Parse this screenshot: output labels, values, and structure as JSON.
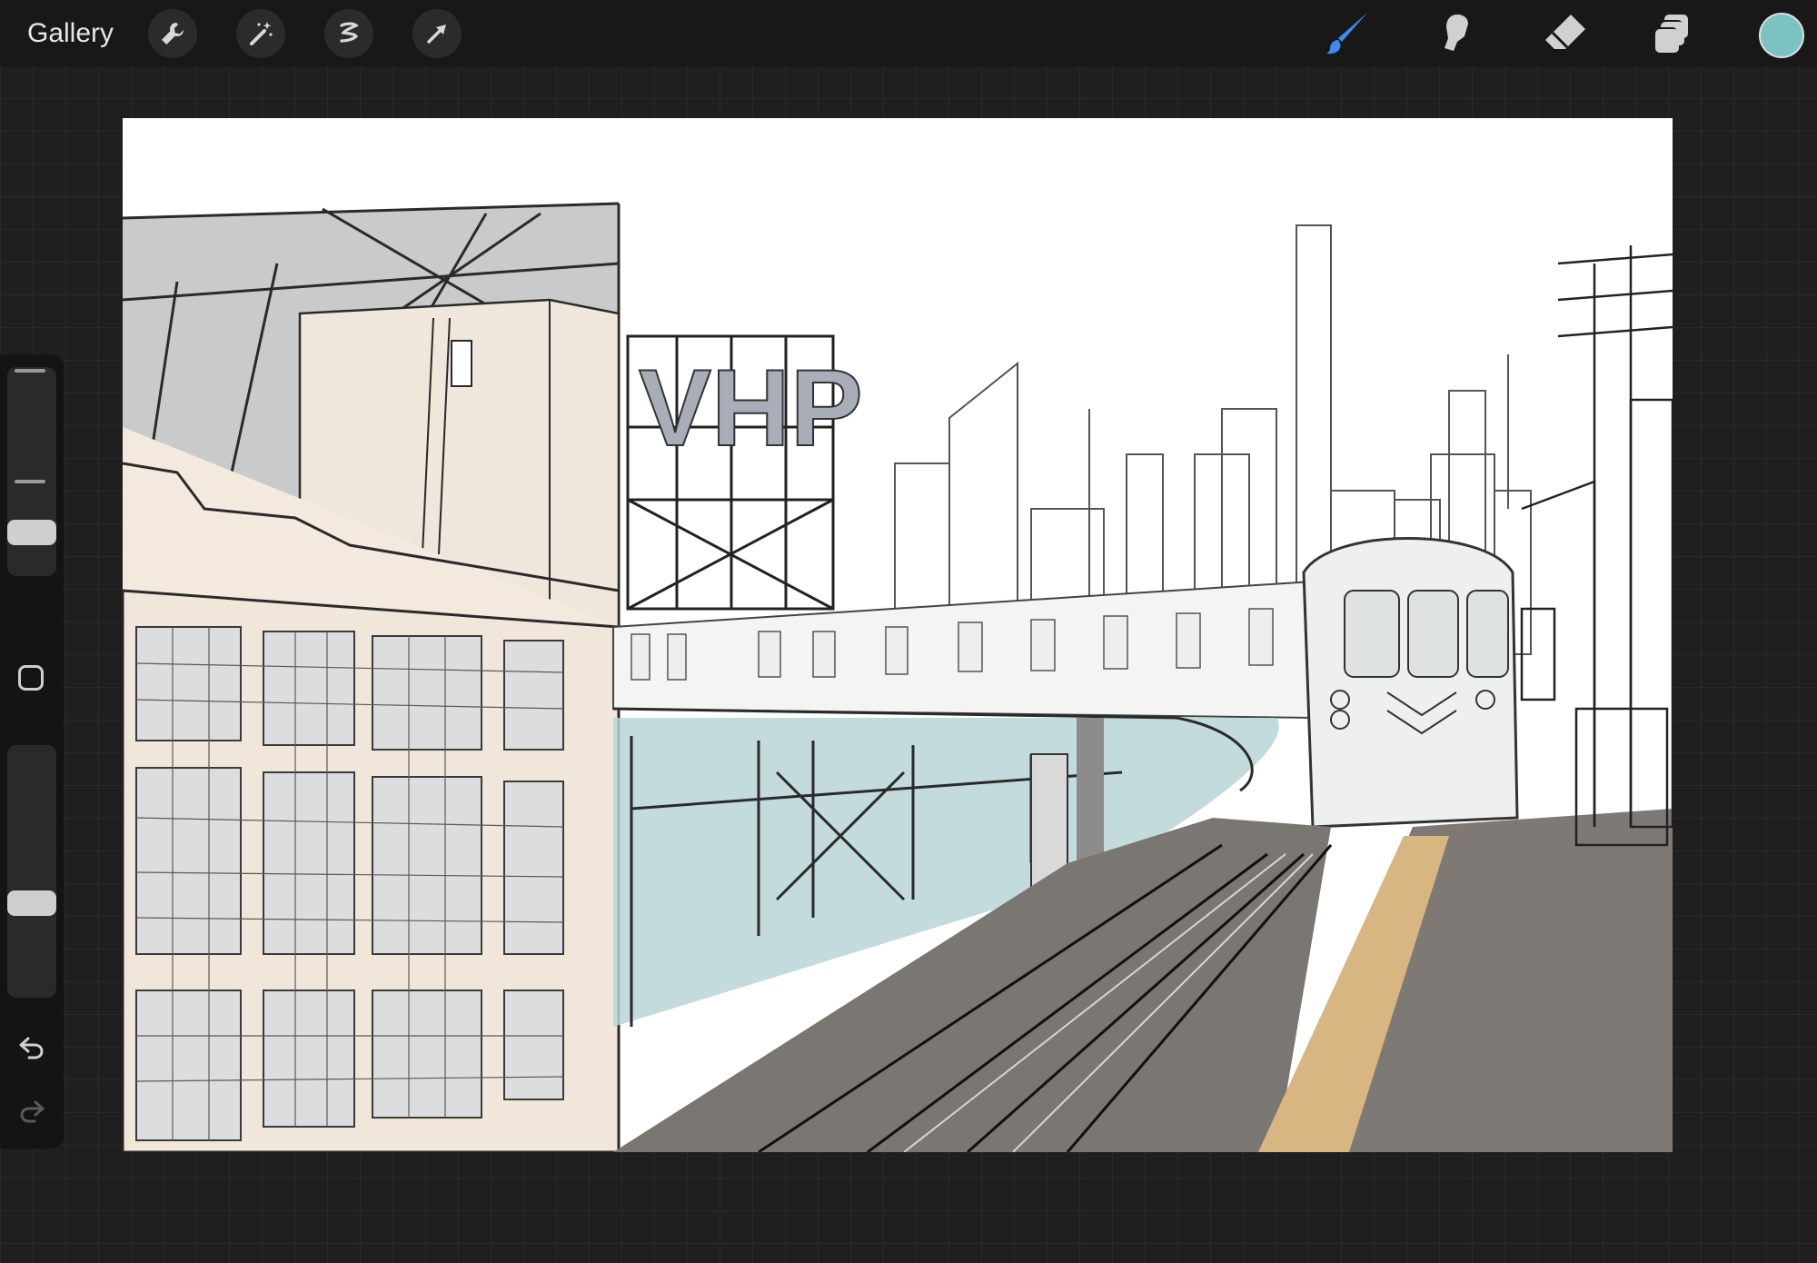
{
  "toolbar": {
    "gallery_label": "Gallery",
    "left_tools": [
      "wrench-icon",
      "magic-wand-icon",
      "selection-icon",
      "transform-arrow-icon"
    ],
    "right_tools": [
      "brush-icon",
      "smudge-icon",
      "eraser-icon",
      "layers-icon"
    ],
    "active_tool": "brush-icon",
    "current_color": "#7cc2c2",
    "accent_color": "#3c8cf0"
  },
  "sidebar": {
    "brush_size_level": 0.4,
    "opacity_level": 0.4,
    "undo_icon": "undo-icon",
    "redo_icon": "redo-icon"
  },
  "canvas": {
    "content": "urban-sketch",
    "sign_letters": "VHP"
  }
}
